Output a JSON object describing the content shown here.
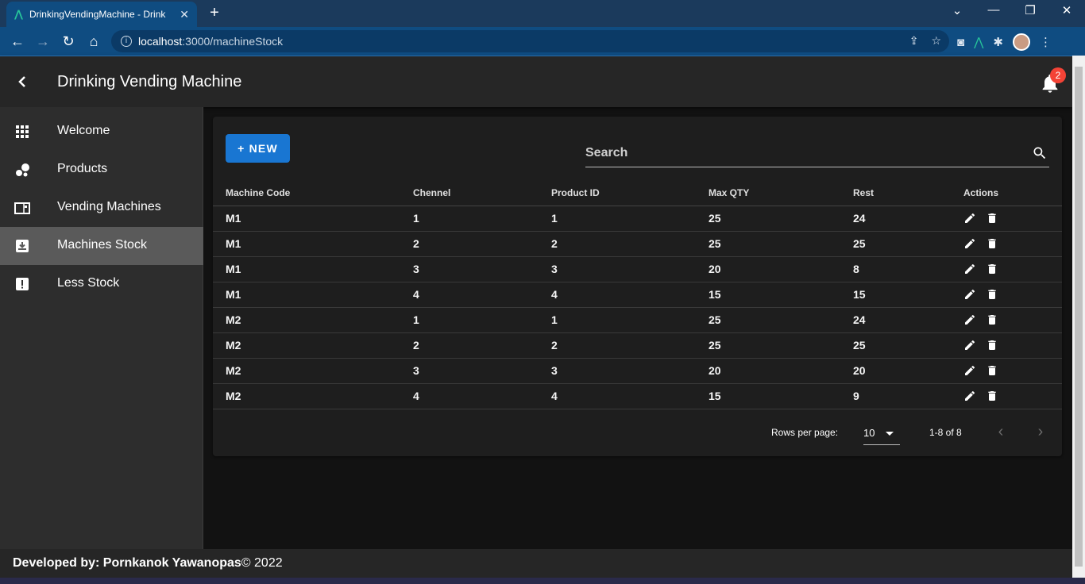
{
  "browser": {
    "tab_title": "DrinkingVendingMachine - Drink",
    "url_host": "localhost",
    "url_path": ":3000/machineStock"
  },
  "app": {
    "title": "Drinking Vending Machine",
    "notification_count": "2"
  },
  "sidebar": {
    "items": [
      {
        "label": "Welcome",
        "icon": "apps-icon"
      },
      {
        "label": "Products",
        "icon": "bubbles-icon"
      },
      {
        "label": "Vending Machines",
        "icon": "machine-icon"
      },
      {
        "label": "Machines Stock",
        "icon": "inbox-download-icon",
        "active": true
      },
      {
        "label": "Less Stock",
        "icon": "warning-icon"
      }
    ]
  },
  "main": {
    "new_button": "+ NEW",
    "search_placeholder": "Search",
    "columns": [
      "Machine Code",
      "Chennel",
      "Product ID",
      "Max QTY",
      "Rest",
      "Actions"
    ],
    "rows": [
      [
        "M1",
        "1",
        "1",
        "25",
        "24"
      ],
      [
        "M1",
        "2",
        "2",
        "25",
        "25"
      ],
      [
        "M1",
        "3",
        "3",
        "20",
        "8"
      ],
      [
        "M1",
        "4",
        "4",
        "15",
        "15"
      ],
      [
        "M2",
        "1",
        "1",
        "25",
        "24"
      ],
      [
        "M2",
        "2",
        "2",
        "25",
        "25"
      ],
      [
        "M2",
        "3",
        "3",
        "20",
        "20"
      ],
      [
        "M2",
        "4",
        "4",
        "15",
        "9"
      ]
    ],
    "pagination": {
      "rows_per_page_label": "Rows per page:",
      "rows_per_page": "10",
      "range": "1-8 of 8"
    }
  },
  "footer": {
    "developed_by": "Developed by: Pornkanok Yawanopas",
    "copyright": "© 2022"
  },
  "colors": {
    "accent": "#1976d2",
    "badge": "#f44336",
    "header_bg": "#262626",
    "sidebar_bg": "#2d2d2d",
    "active_item": "#5a5a5a"
  }
}
